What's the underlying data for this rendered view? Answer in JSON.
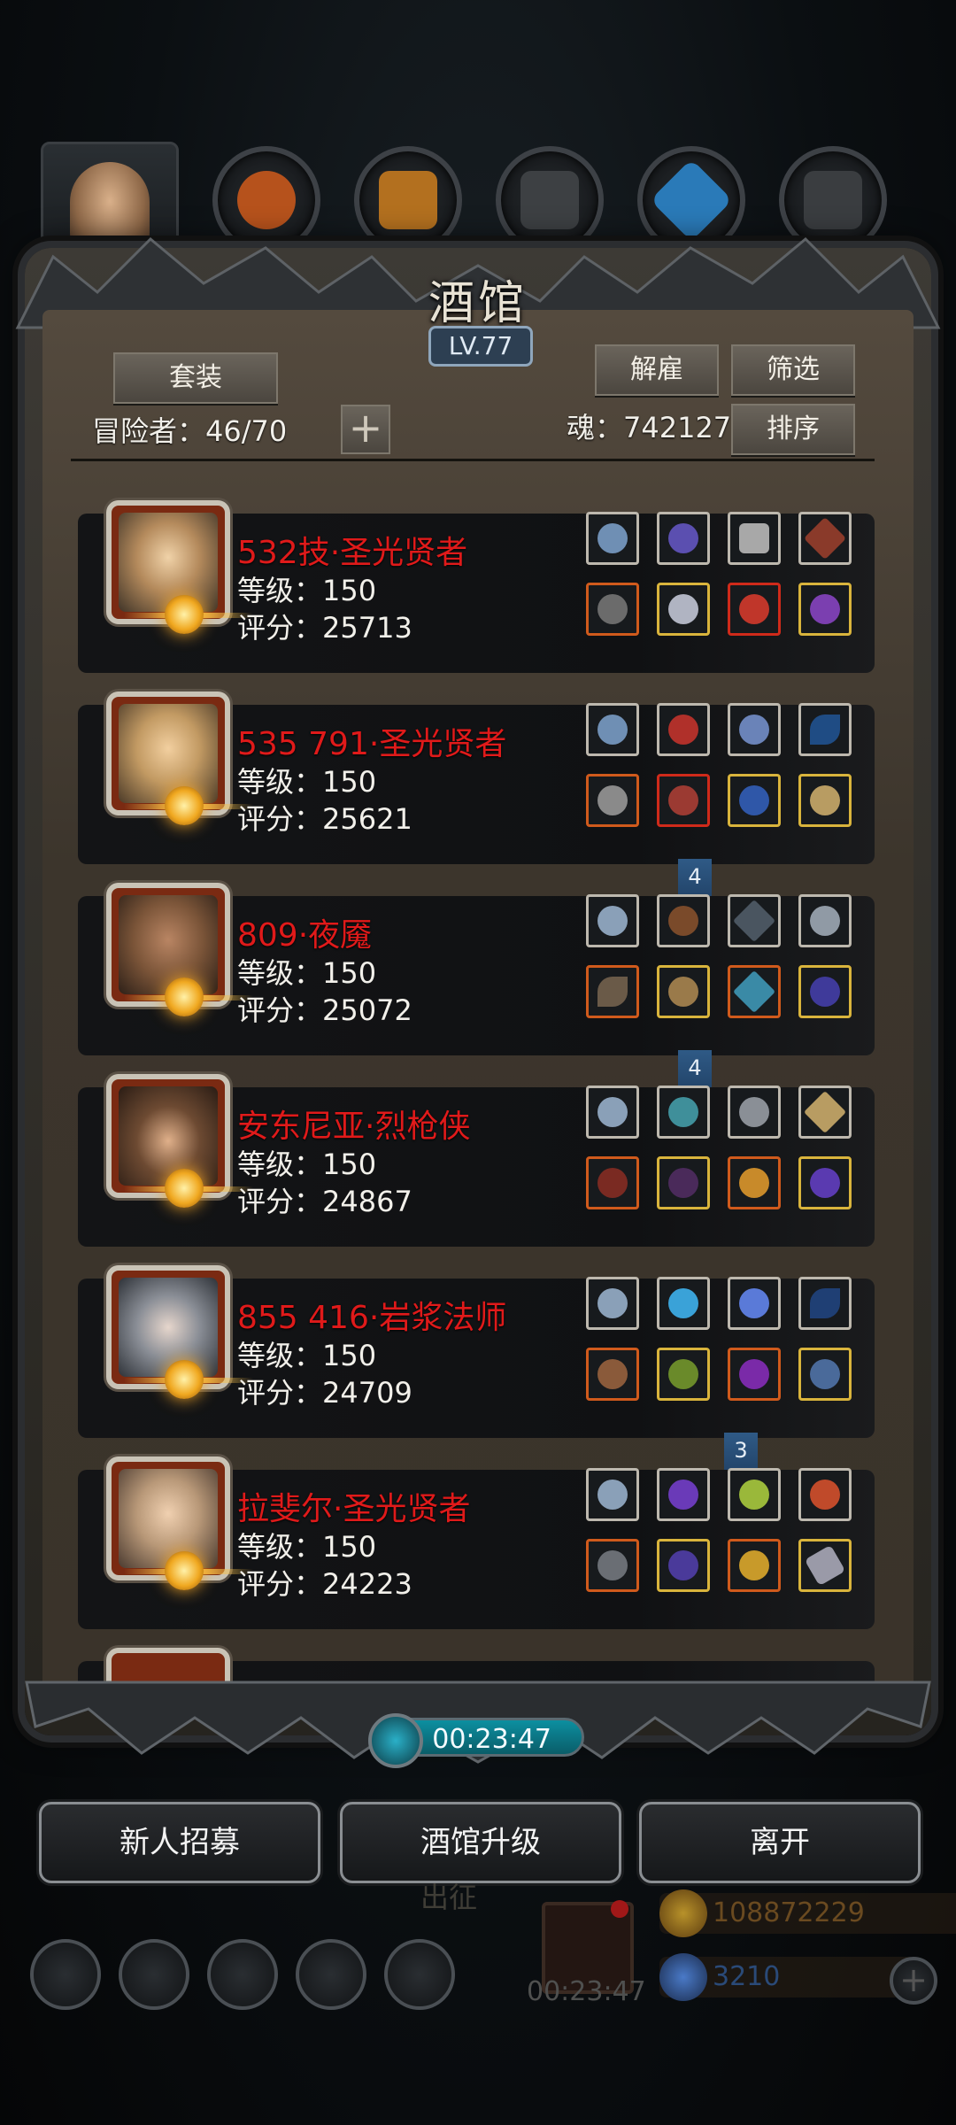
{
  "window": {
    "title": "酒馆",
    "level": "LV.77"
  },
  "header": {
    "suit_label": "套装",
    "dismiss_label": "解雇",
    "filter_label": "筛选",
    "sort_label": "排序",
    "adventurers_label": "冒险者：46/70",
    "soul_label": "魂：742127"
  },
  "heroes": [
    {
      "name": "532技·圣光贤者",
      "level": "等级：150",
      "score": "评分：25713"
    },
    {
      "name": "535 791·圣光贤者",
      "level": "等级：150",
      "score": "评分：25621"
    },
    {
      "name": "809·夜魇",
      "level": "等级：150",
      "score": "评分：25072"
    },
    {
      "name": "安东尼亚·烈枪侠",
      "level": "等级：150",
      "score": "评分：24867"
    },
    {
      "name": "855 416·岩浆法师",
      "level": "等级：150",
      "score": "评分：24709"
    },
    {
      "name": "拉斐尔·圣光贤者",
      "level": "等级：150",
      "score": "评分：24223"
    }
  ],
  "markers": [
    "4",
    "4",
    "3"
  ],
  "timer": "00:23:47",
  "actions": {
    "recruit": "新人招募",
    "upgrade": "酒馆升级",
    "leave": "离开"
  },
  "background": {
    "expedition": "出征",
    "gift_timer": "00:23:47",
    "gold": "108872229",
    "gems": "3210"
  },
  "colors": {
    "hero_name": "#e01a1a",
    "panel": "#3c352c",
    "timer": "#0c8fa0"
  }
}
